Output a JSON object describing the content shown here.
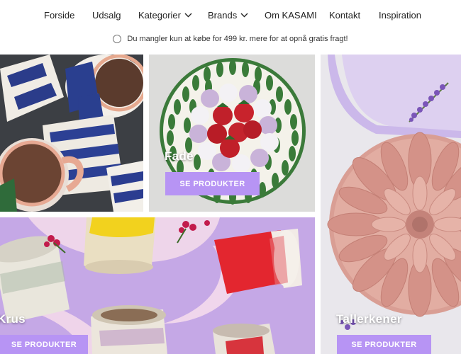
{
  "nav": {
    "items": [
      {
        "label": "Forside",
        "has_dropdown": false
      },
      {
        "label": "Udsalg",
        "has_dropdown": false
      },
      {
        "label": "Kategorier",
        "has_dropdown": true
      },
      {
        "label": "Brands",
        "has_dropdown": true
      },
      {
        "label": "Om KASAMI",
        "has_dropdown": false
      },
      {
        "label": "Kontakt",
        "has_dropdown": false
      },
      {
        "label": "Inspiration",
        "has_dropdown": false
      }
    ]
  },
  "shipping": {
    "text": "Du mangler kun at købe for 499 kr. mere for at opnå gratis fragt!",
    "icon": "circle-progress-icon"
  },
  "tiles": {
    "mugs_top": {
      "label": "",
      "cta": ""
    },
    "fade": {
      "label": "Fade",
      "cta": "SE PRODUKTER"
    },
    "krus": {
      "label": "Krus",
      "cta": "SE PRODUKTER"
    },
    "tallerkener": {
      "label": "Tallerkener",
      "cta": "SE PRODUKTER"
    }
  },
  "colors": {
    "accent": "#b794f4",
    "text": "#222222"
  }
}
